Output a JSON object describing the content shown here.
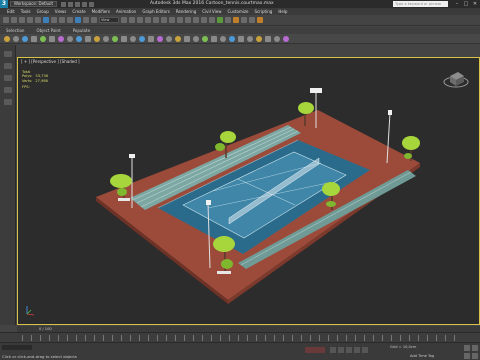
{
  "titlebar": {
    "logo": "3",
    "workspace": "Workspace: Default",
    "title": "Autodesk 3ds Max 2016     Cartoon_tennis.courtmax.max",
    "search_placeholder": "Type a keyword or phrase",
    "minimize": "–",
    "maximize": "□",
    "close": "✕"
  },
  "menu": [
    "Edit",
    "Tools",
    "Group",
    "Views",
    "Create",
    "Modifiers",
    "Animation",
    "Graph Editors",
    "Rendering",
    "Civil View",
    "Customize",
    "Scripting",
    "Help"
  ],
  "toolbar": {
    "dropdown": "View"
  },
  "ribbon": {
    "tabs": [
      "Selection",
      "Object Paint",
      "Populate"
    ]
  },
  "viewport": {
    "label": "[ + ] [Perspective ] [Shaded ]",
    "stats": {
      "total_label": "Total",
      "polys_label": "Polys:",
      "polys_value": "53,736",
      "verts_label": "Verts:",
      "verts_value": "27,986",
      "fps_label": "FPS:"
    }
  },
  "timebar": {
    "frame": "0 / 100"
  },
  "status": {
    "maxscript": "",
    "prompt": "Click or click-and-drag to select objects",
    "grid": "Grid = 10,0cm",
    "add_tag": "Add Time Tag"
  },
  "colors": {
    "court_base": "#9c4b3a",
    "court_blue": "#2a6b8c",
    "court_inner": "#3f86a8",
    "tree": "#a6d63b",
    "bleacher": "#7da7a3"
  }
}
